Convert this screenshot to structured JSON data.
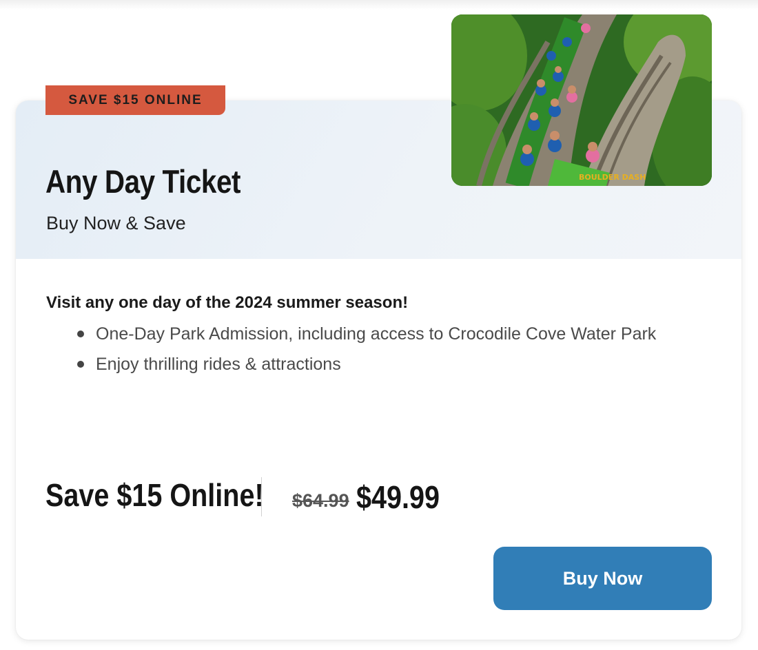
{
  "ticket": {
    "badge": "SAVE $15 ONLINE",
    "title": "Any Day Ticket",
    "subtitle": "Buy Now & Save",
    "intro": "Visit any one day of the 2024 summer season!",
    "features": [
      "One-Day Park Admission, including access to Crocodile Cove Water Park",
      "Enjoy thrilling rides & attractions"
    ],
    "promo": "Save $15 Online!",
    "old_price": "$64.99",
    "new_price": "$49.99",
    "buy_label": "Buy Now"
  },
  "colors": {
    "badge_bg": "#d5593f",
    "button_bg": "#317eb7",
    "header_bg": "#e8eff7"
  },
  "hero_image": {
    "subject": "roller-coaster-riders-photo",
    "coaster_sign": "BOULDER DASH"
  }
}
